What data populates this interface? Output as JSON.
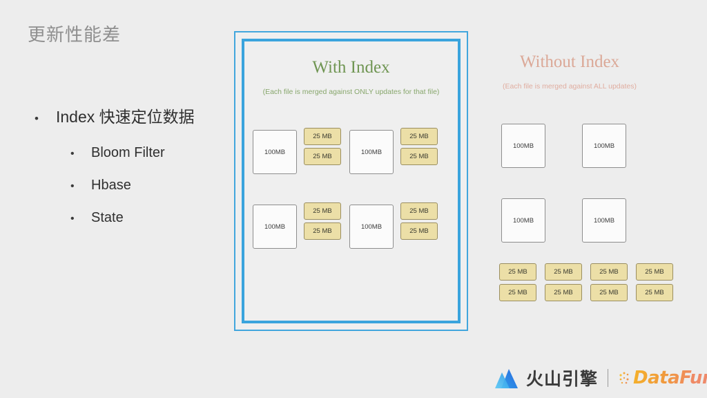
{
  "slide": {
    "title": "更新性能差"
  },
  "bullets": [
    {
      "level": 0,
      "marker": "•",
      "text": "Index 快速定位数据"
    },
    {
      "level": 1,
      "marker": "•",
      "text": "Bloom Filter"
    },
    {
      "level": 1,
      "marker": "•",
      "text": "Hbase"
    },
    {
      "level": 1,
      "marker": "•",
      "text": "State"
    }
  ],
  "panels": {
    "with_index": {
      "heading": "With Index",
      "subtitle": "(Each file is merged against ONLY updates for that file)",
      "heading_color": "#6f9552",
      "subtitle_color": "#88a76d",
      "frame_color": "#3aa4dd",
      "groups": [
        {
          "base_label": "100MB",
          "updates": [
            "25 MB",
            "25 MB"
          ]
        },
        {
          "base_label": "100MB",
          "updates": [
            "25 MB",
            "25 MB"
          ]
        },
        {
          "base_label": "100MB",
          "updates": [
            "25 MB",
            "25 MB"
          ]
        },
        {
          "base_label": "100MB",
          "updates": [
            "25 MB",
            "25 MB"
          ]
        }
      ]
    },
    "without_index": {
      "heading": "Without Index",
      "subtitle": "(Each file is merged against ALL updates)",
      "heading_color": "#dba897",
      "subtitle_color": "#e0ada0",
      "base_files": [
        "100MB",
        "100MB",
        "100MB",
        "100MB"
      ],
      "update_pool": [
        "25 MB",
        "25 MB",
        "25 MB",
        "25 MB",
        "25 MB",
        "25 MB",
        "25 MB",
        "25 MB"
      ]
    }
  },
  "footer": {
    "volcano_text": "火山引擎",
    "divider": "|",
    "datafun_text": "DataFun.",
    "volcano_icon": "volcano-mountain-icon",
    "datafun_icon": "datafun-dots-icon"
  },
  "colors": {
    "background": "#ededed",
    "box_100mb_fill": "#fbfbfb",
    "box_100mb_border": "#8d8d8d",
    "box_25mb_fill": "#ecdfa7",
    "box_25mb_border": "#9a8e60",
    "title_gray": "#8f8f8f",
    "accent_blue": "#3aa4dd"
  }
}
